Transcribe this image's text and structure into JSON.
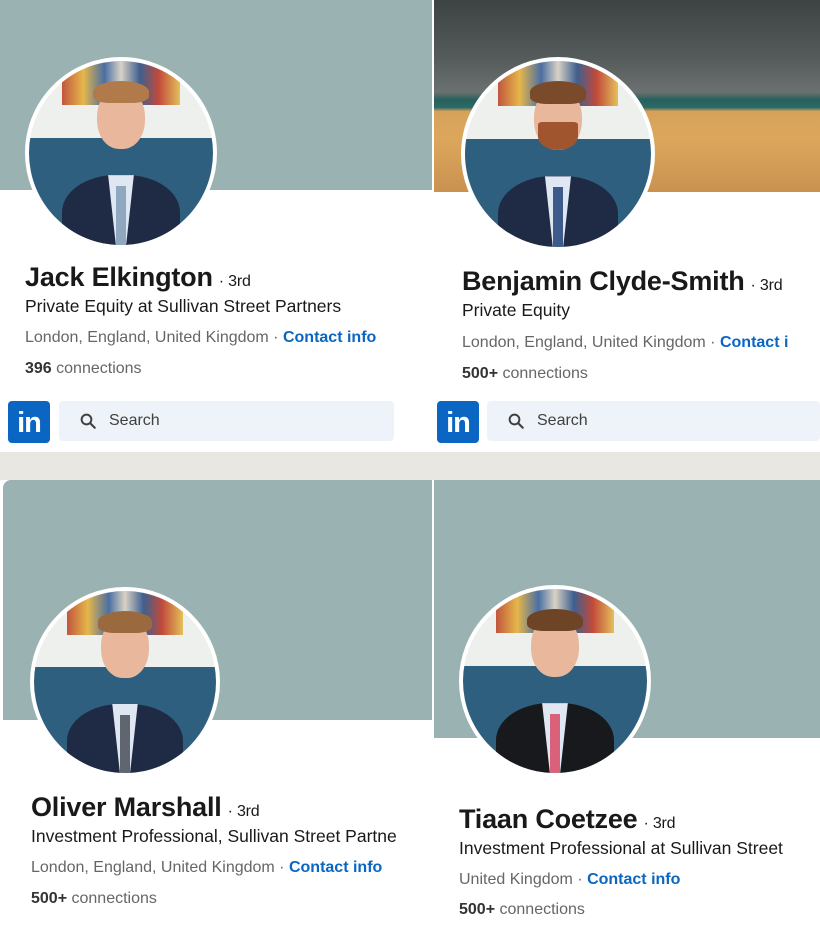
{
  "profiles": [
    {
      "name": "Jack Elkington",
      "degree": "· 3rd",
      "headline": "Private Equity at Sullivan Street Partners",
      "location": "London, England, United Kingdom ·",
      "contact": "Contact info",
      "connections_count": "396",
      "connections_label": "connections"
    },
    {
      "name": "Benjamin Clyde-Smith",
      "degree": "· 3rd",
      "headline": "Private Equity",
      "location": "London, England, United Kingdom ·",
      "contact": "Contact i",
      "connections_count": "500+",
      "connections_label": "connections"
    },
    {
      "name": "Oliver Marshall",
      "degree": "· 3rd",
      "headline": "Investment Professional, Sullivan Street Partne",
      "location": "London, England, United Kingdom ·",
      "contact": "Contact info",
      "connections_count": "500+",
      "connections_label": "connections"
    },
    {
      "name": "Tiaan Coetzee",
      "degree": "· 3rd",
      "headline": "Investment Professional at Sullivan Street",
      "location": "United Kingdom ·",
      "contact": "Contact info",
      "connections_count": "500+",
      "connections_label": "connections"
    }
  ],
  "navbars": [
    {
      "logo": "in",
      "search_placeholder": "Search"
    },
    {
      "logo": "in",
      "search_placeholder": "Search"
    }
  ],
  "colors": {
    "linkedin_blue": "#0a66c2",
    "banner_teal": "#9bb2b2",
    "search_bg": "#edf3f8"
  }
}
